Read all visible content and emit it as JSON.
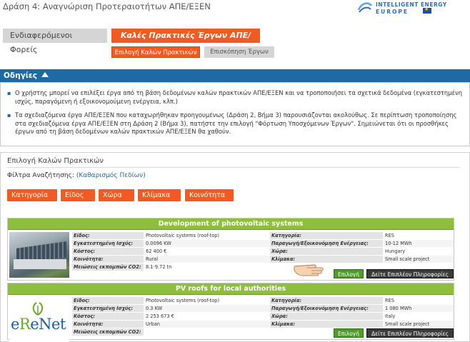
{
  "header": {
    "title": "Δράση 4: Αναγνώριση Προτεραιοτήτων ΑΠΕ/ΕΞΕΝ",
    "brand_line1": "INTELLIGENT ENERGY",
    "brand_line2": "EUROPE"
  },
  "tabs": {
    "stakeholders": "Ενδιαφερόμενοι Φορείς",
    "best_practices": "Καλές Πρακτικές Έργων ΑΠΕ/ΕΞΕΝ",
    "sub_select": "Επιλογή Καλών Πρακτικών",
    "sub_review": "Επισκόπηση Έργων"
  },
  "instructions": {
    "title": "Οδηγίες",
    "items": [
      "Ο χρήστης μπορεί να επιλέξει έργα από τη βάση δεδομένων καλών πρακτικών ΑΠΕ/ΕΞΕΝ και να τροποποιήσει τα σχετικά δεδομένα (εγκατεστημένη ισχύς, παραγόμενη ή εξοικονομούμενη ενέργεια, κλπ.)",
      "Τα σχεδιαζόμενα έργα ΑΠΕ/ΕΞΕΝ που καταχωρήθηκαν προηγουμένως (Δράση 2, Βήμα 3) παρουσιάζονται ακολούθως. Σε περίπτωση τροποποίησης στα σχεδιαζόμενα έργα ΑΠΕ/ΕΞΕΝ στη Δράση 2 (Βήμα 3), πατήστε την επιλογή \"Φόρτωση Υποσχόμενων Έργων\". Σημειώνεται ότι οι προσθήκες έργων από τη βάση δεδομένων καλών πρακτικών ΑΠΕ/ΕΞΕΝ θα χαθούν."
    ]
  },
  "best_practices": {
    "title": "Επιλογή Καλών Πρακτικών",
    "filters_label": "Φίλτρα Αναζήτησης:",
    "clear_filters": "(Καθαρισμός Πεδίων)",
    "filters": [
      "Κατηγορία",
      "Είδος",
      "Χώρα",
      "Κλίμακα",
      "Κοινότητα"
    ],
    "select_label": "Επιλογή",
    "more_label": "Δείτε Επιπλέον Πληροφορίες",
    "projects": [
      {
        "title": "Development of photovoltaic systems",
        "fields": [
          {
            "l1": "Είδος:",
            "v1": "Photovoltaic systems (roof-top)",
            "l2": "Κατηγορία:",
            "v2": "RES"
          },
          {
            "l1": "Εγκατεστημένη Ισχύς:",
            "v1": "0.0096 KW",
            "l2": "Παραγωγή/Εξοικονόμηση Ενέργειας:",
            "v2": "10-12 MWh"
          },
          {
            "l1": "Κόστος:",
            "v1": "62 400 €",
            "l2": "Χώρα:",
            "v2": "Hungary"
          },
          {
            "l1": "Κοινότητα:",
            "v1": "Rural",
            "l2": "Κλίμακα:",
            "v2": "Small scale project"
          },
          {
            "l1": "Μειώσεις εκπομπών CO2:",
            "v1": "8.1-9.72 tn",
            "l2": "",
            "v2": ""
          }
        ]
      },
      {
        "title": "PV roofs for local authorities",
        "fields": [
          {
            "l1": "Είδος:",
            "v1": "Photovoltaic systems (roof-top)",
            "l2": "Κατηγορία:",
            "v2": "RES"
          },
          {
            "l1": "Εγκατεστημένη Ισχύς:",
            "v1": "0.3 KW",
            "l2": "Παραγωγή/Εξοικονόμηση Ενέργειας:",
            "v2": "1 080 MWh"
          },
          {
            "l1": "Κόστος:",
            "v1": "2 253 673 €",
            "l2": "Χώρα:",
            "v2": "Italy"
          },
          {
            "l1": "Κοινότητα:",
            "v1": "Urban",
            "l2": "Κλίμακα:",
            "v2": "Small scale project"
          },
          {
            "l1": "Μειώσεις εκπομπών CO2:",
            "v1": "",
            "l2": "",
            "v2": ""
          }
        ],
        "logo_text_1": "e",
        "logo_text_2": "R",
        "logo_text_3": "eNet"
      }
    ]
  },
  "colors": {
    "accent": "#f15a22",
    "header_blue": "#1e6aa4",
    "card_green": "#8dbe3c"
  }
}
